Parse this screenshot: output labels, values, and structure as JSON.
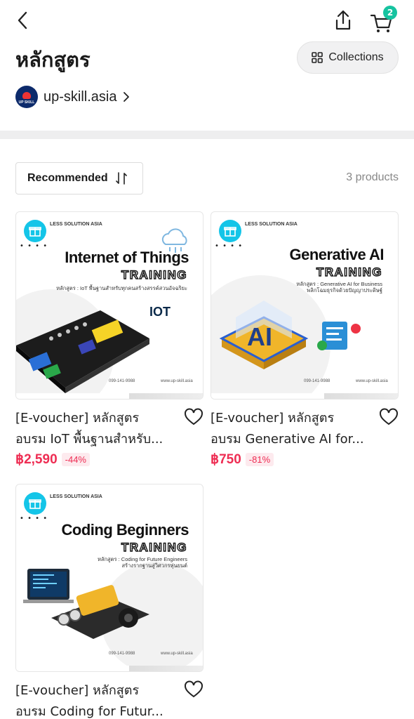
{
  "header": {
    "title": "หลักสูตร",
    "cart_count": "2",
    "collections_label": "Collections"
  },
  "shop": {
    "name": "up-skill.asia",
    "avatar_text": "UP SKILL"
  },
  "toolbar": {
    "sort_label": "Recommended",
    "count_label": "3 products"
  },
  "colors": {
    "price": "#ee2d53",
    "badge": "#16c3a0",
    "gift": "#14c5e8"
  },
  "products": [
    {
      "thumb": {
        "brand": "LESS SOLUTION ASIA",
        "title": "Internet of Things",
        "training": "TRAINING",
        "subtitle": "หลักสูตร : IoT พื้นฐานสำหรับทุกคนสร้างสรรค์สวนอัจฉริยะ",
        "tag": "IOT",
        "phone": "099-141-9988",
        "site": "www.up-skill.asia"
      },
      "title_line1": "[E-voucher] หลักสูตร",
      "title_line2": "อบรม IoT พื้นฐานสำหรับ...",
      "price": "฿2,590",
      "discount": "-44%"
    },
    {
      "thumb": {
        "brand": "LESS SOLUTION ASIA",
        "title": "Generative AI",
        "training": "TRAINING",
        "subtitle": "หลักสูตร : Generative AI for Business",
        "subtitle2": "พลิกโฉมธุรกิจด้วยปัญญาประดิษฐ์",
        "tag": "AI",
        "phone": "099-141-9988",
        "site": "www.up-skill.asia"
      },
      "title_line1": "[E-voucher] หลักสูตร",
      "title_line2": "อบรม Generative AI for...",
      "price": "฿750",
      "discount": "-81%"
    },
    {
      "thumb": {
        "brand": "LESS SOLUTION ASIA",
        "title": "Coding Beginners",
        "training": "TRAINING",
        "subtitle": "หลักสูตร : Coding for Future Engineers",
        "subtitle2": "สร้างรากฐานสู่วิศวกรหุ่นยนต์",
        "phone": "099-141-9988",
        "site": "www.up-skill.asia"
      },
      "title_line1": "[E-voucher] หลักสูตร",
      "title_line2": "อบรม Coding for Futur..."
    }
  ]
}
